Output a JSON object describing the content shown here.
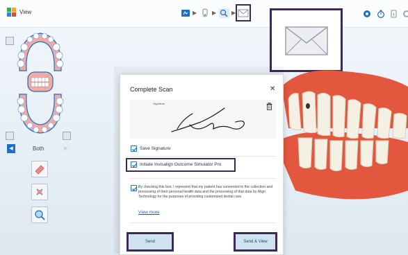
{
  "app": {
    "title": "View",
    "brand_colors": [
      "#2db34a",
      "#f2a51d",
      "#2a86d6",
      "#d94b3d"
    ]
  },
  "toolbar": {
    "icons": [
      "scan-icon",
      "arrow-right-icon",
      "tooth-icon",
      "arrow-right-icon",
      "search-teeth-icon",
      "arrow-right-icon",
      "envelope-icon"
    ],
    "right_icons": [
      "camera-icon",
      "timer-icon",
      "settings-icon",
      "info-icon"
    ]
  },
  "left_panel": {
    "jaw_label": "Both",
    "tools": [
      "eraser-icon",
      "trim-icon",
      "zoom-tooth-icon"
    ]
  },
  "dialog": {
    "title": "Complete Scan",
    "close_glyph": "✕",
    "signature_label": "Signature",
    "save_signature": {
      "label": "Save Signature",
      "checked": true
    },
    "invisalign": {
      "label": "Initiate Invisalign Outcome Simulator Pro",
      "checked": true
    },
    "consent": {
      "checked": true,
      "text": "By checking this box, I represent that my patient has consented to the collection and processing of their personal health data and the processing of that data by Align Technology for the purposes of providing customized dental care."
    },
    "view_more": "View more",
    "send_label": "Send",
    "send_view_label": "Send & View"
  },
  "colors": {
    "highlight_border": "#3a2a55",
    "primary_blue": "#1e6fbf",
    "gum": "#e3573f",
    "tooth": "#f4f1e4",
    "button_bg": "#cfe3ef"
  }
}
